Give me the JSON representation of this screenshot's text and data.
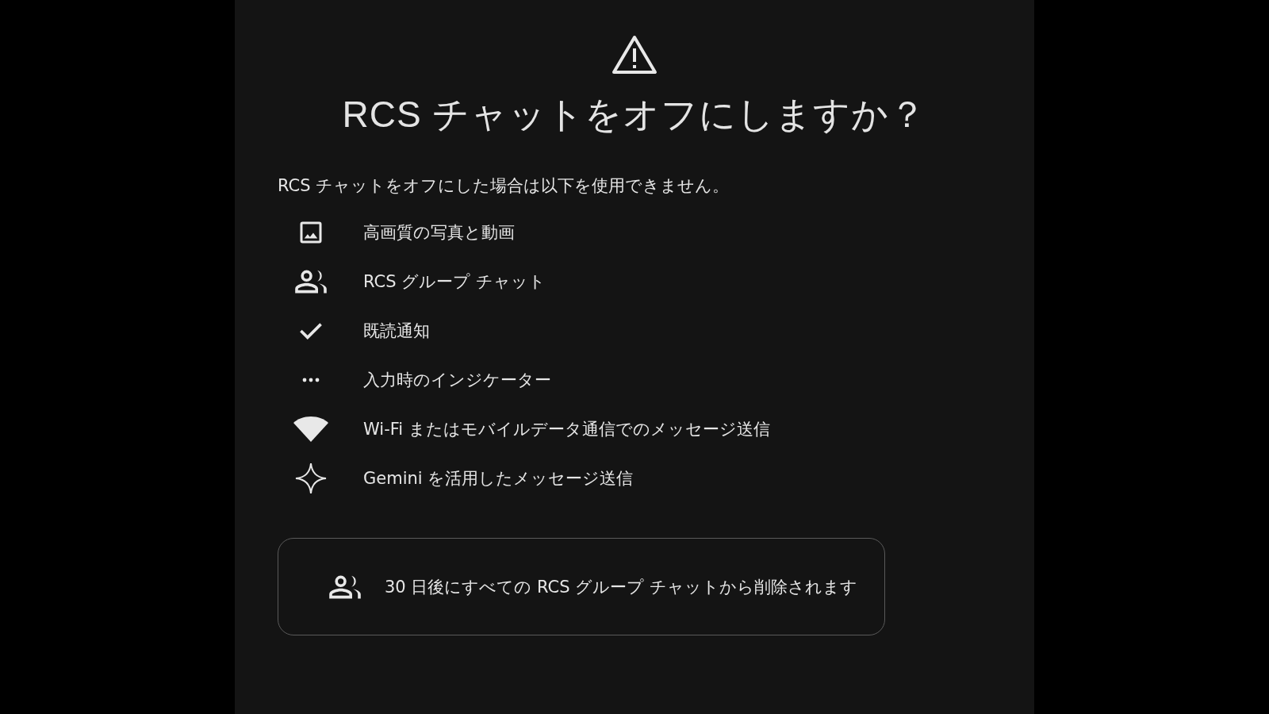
{
  "dialog": {
    "title": "RCS チャットをオフにしますか？",
    "intro": "RCS チャットをオフにした場合は以下を使用できません。",
    "features": [
      {
        "kind": "image",
        "label": "高画質の写真と動画"
      },
      {
        "kind": "group",
        "label": "RCS グループ チャット"
      },
      {
        "kind": "check",
        "label": "既読通知"
      },
      {
        "kind": "dots",
        "label": "入力時のインジケーター"
      },
      {
        "kind": "wifi",
        "label": "Wi-Fi またはモバイルデータ通信でのメッセージ送信"
      },
      {
        "kind": "sparkle",
        "label": "Gemini を活用したメッセージ送信"
      }
    ],
    "notice": {
      "kind": "group",
      "text": "30 日後にすべての RCS グループ チャットから削除されます"
    }
  }
}
